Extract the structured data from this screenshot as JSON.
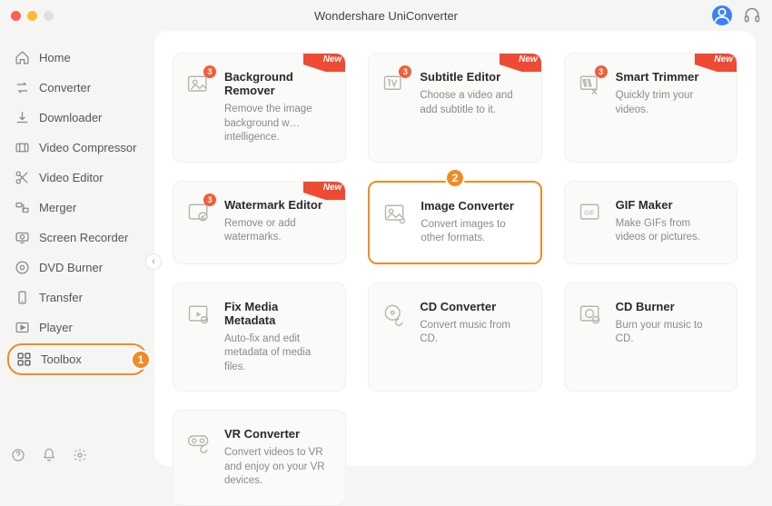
{
  "app_title": "Wondershare UniConverter",
  "annotations": {
    "one": "1",
    "two": "2"
  },
  "sidebar": {
    "items": [
      {
        "label": "Home"
      },
      {
        "label": "Converter"
      },
      {
        "label": "Downloader"
      },
      {
        "label": "Video Compressor"
      },
      {
        "label": "Video Editor"
      },
      {
        "label": "Merger"
      },
      {
        "label": "Screen Recorder"
      },
      {
        "label": "DVD Burner"
      },
      {
        "label": "Transfer"
      },
      {
        "label": "Player"
      },
      {
        "label": "Toolbox"
      }
    ]
  },
  "tools": [
    {
      "title": "Background Remover",
      "desc": "Remove the image background w… intelligence.",
      "new": true,
      "badge": "3"
    },
    {
      "title": "Subtitle Editor",
      "desc": "Choose a video and add subtitle to it.",
      "new": true,
      "badge": "3"
    },
    {
      "title": "Smart Trimmer",
      "desc": "Quickly trim your videos.",
      "new": true,
      "badge": "3"
    },
    {
      "title": "Watermark Editor",
      "desc": "Remove or add watermarks.",
      "new": true,
      "badge": "3"
    },
    {
      "title": "Image Converter",
      "desc": "Convert images to other formats.",
      "new": false,
      "badge": ""
    },
    {
      "title": "GIF Maker",
      "desc": "Make GIFs from videos or pictures.",
      "new": false,
      "badge": ""
    },
    {
      "title": "Fix Media Metadata",
      "desc": "Auto-fix and edit metadata of media files.",
      "new": false,
      "badge": ""
    },
    {
      "title": "CD Converter",
      "desc": "Convert music from CD.",
      "new": false,
      "badge": ""
    },
    {
      "title": "CD Burner",
      "desc": "Burn your music to CD.",
      "new": false,
      "badge": ""
    },
    {
      "title": "VR Converter",
      "desc": "Convert videos to VR and enjoy on your VR devices.",
      "new": false,
      "badge": ""
    }
  ],
  "new_label": "New"
}
